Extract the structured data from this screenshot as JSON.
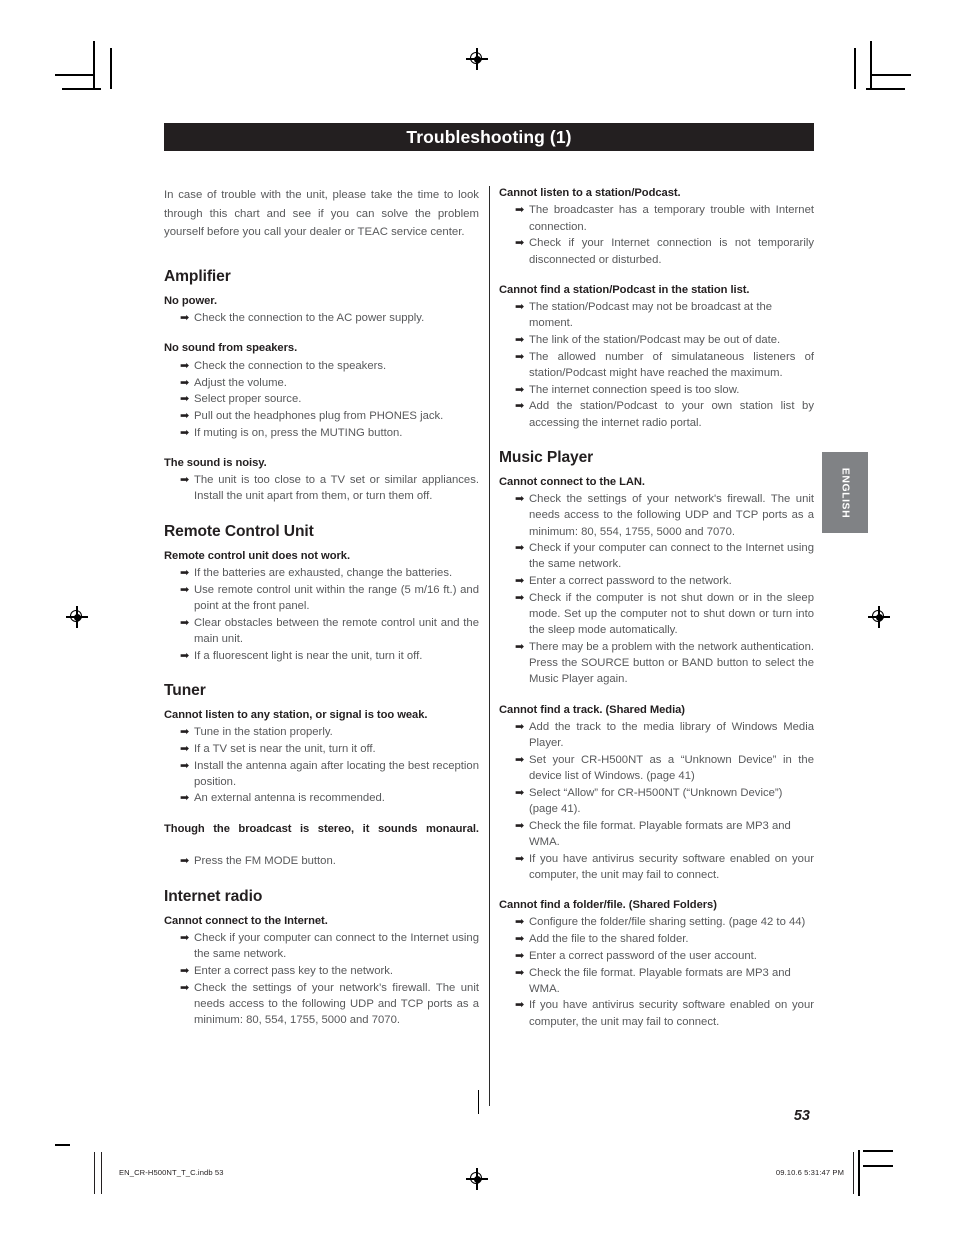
{
  "page": {
    "header_title": "Troubleshooting (1)",
    "page_number": "53",
    "side_tab": "ENGLISH",
    "footer_file": "EN_CR-H500NT_T_C.indb   53",
    "footer_timestamp": "09.10.6   5:31:47 PM",
    "colors": {
      "header_bar": "#231f20",
      "header_text": "#ffffff",
      "body_text": "#58595b",
      "heading_text": "#231f20",
      "side_tab_bg": "#808285"
    },
    "arrow_glyph": "➡"
  },
  "intro": "In case of trouble with the unit, please take the time to look through this chart and see if you can solve the problem yourself before you call your dealer or TEAC service center.",
  "left_column": [
    {
      "section": "Amplifier",
      "groups": [
        {
          "symptom": "No power.",
          "remedies": [
            "Check the connection to the AC power supply."
          ]
        },
        {
          "symptom": "No sound from speakers.",
          "remedies": [
            "Check the connection to the speakers.",
            "Adjust the volume.",
            "Select proper source.",
            "Pull out the headphones plug from PHONES jack.",
            "If muting is on, press the MUTING button."
          ]
        },
        {
          "symptom": "The sound is noisy.",
          "remedies": [
            "The unit is too close to a TV set or similar appliances. Install the unit apart from them, or turn them off."
          ]
        }
      ]
    },
    {
      "section": "Remote Control Unit",
      "groups": [
        {
          "symptom": "Remote control unit does not work.",
          "remedies": [
            "If the batteries are exhausted, change the batteries.",
            "Use remote control unit within the range (5 m/16 ft.) and point at the front panel.",
            "Clear obstacles between the remote control unit and the main unit.",
            "If a fluorescent light is near the unit, turn it off."
          ]
        }
      ]
    },
    {
      "section": "Tuner",
      "groups": [
        {
          "symptom": "Cannot listen to any station, or signal is too weak.",
          "remedies": [
            "Tune in the station properly.",
            "If a TV set is near the unit, turn it off.",
            "Install the antenna again after locating the best reception position.",
            "An external antenna is recommended."
          ]
        },
        {
          "symptom": "Though the broadcast is stereo, it sounds monaural.",
          "remedies": [
            "Press the FM MODE button."
          ]
        }
      ]
    },
    {
      "section": "Internet radio",
      "groups": [
        {
          "symptom": "Cannot connect to the Internet.",
          "remedies": [
            "Check if your computer can connect to the Internet using the same network.",
            "Enter a correct pass key to the network.",
            "Check the settings of your network’s firewall. The unit needs access to the following UDP and TCP ports as a minimum: 80, 554, 1755, 5000 and 7070."
          ]
        }
      ]
    }
  ],
  "right_column": [
    {
      "section": null,
      "groups": [
        {
          "symptom": "Cannot listen to a station/Podcast.",
          "remedies": [
            "The broadcaster has a temporary trouble with Internet connection.",
            "Check if your Internet connection is not temporarily disconnected or disturbed."
          ]
        },
        {
          "symptom": "Cannot find a station/Podcast in the station list.",
          "remedies": [
            "The station/Podcast may not be broadcast at the moment.",
            "The link of the station/Podcast may be out of date.",
            "The allowed number of simulataneous listeners of station/Podcast might have reached the maximum.",
            "The internet connection speed is too slow.",
            "Add the station/Podcast to your own station list by accessing the internet radio portal."
          ]
        }
      ]
    },
    {
      "section": "Music Player",
      "groups": [
        {
          "symptom": "Cannot connect to the LAN.",
          "remedies": [
            "Check the settings of your network's firewall. The unit needs access to the following UDP and TCP ports as a minimum: 80, 554, 1755, 5000 and 7070.",
            "Check if your computer can connect to the Internet using the same network.",
            "Enter a correct password to the network.",
            "Check if the computer is not shut down or in the sleep mode. Set up the computer not to shut down or turn into the sleep mode automatically.",
            "There may be a problem with the network authentication. Press the SOURCE button or BAND button to select the Music Player again."
          ]
        },
        {
          "symptom": "Cannot find a track. (Shared Media)",
          "remedies": [
            "Add the track to the media library of Windows Media Player.",
            "Set your CR-H500NT as a “Unknown Device” in the device list of Windows. (page 41)",
            "Select “Allow” for CR-H500NT (“Unknown Device”) (page 41).",
            "Check the file format. Playable formats are MP3 and WMA.",
            "If you have antivirus security software enabled on your computer, the unit may fail to connect."
          ]
        },
        {
          "symptom": "Cannot find a folder/file. (Shared Folders)",
          "remedies": [
            "Configure the folder/file sharing setting. (page 42 to 44)",
            "Add the file to the shared folder.",
            "Enter a correct password of the user account.",
            "Check the file format. Playable formats are MP3 and WMA.",
            "If you have antivirus security software enabled on your computer, the unit may fail to connect."
          ]
        }
      ]
    }
  ]
}
